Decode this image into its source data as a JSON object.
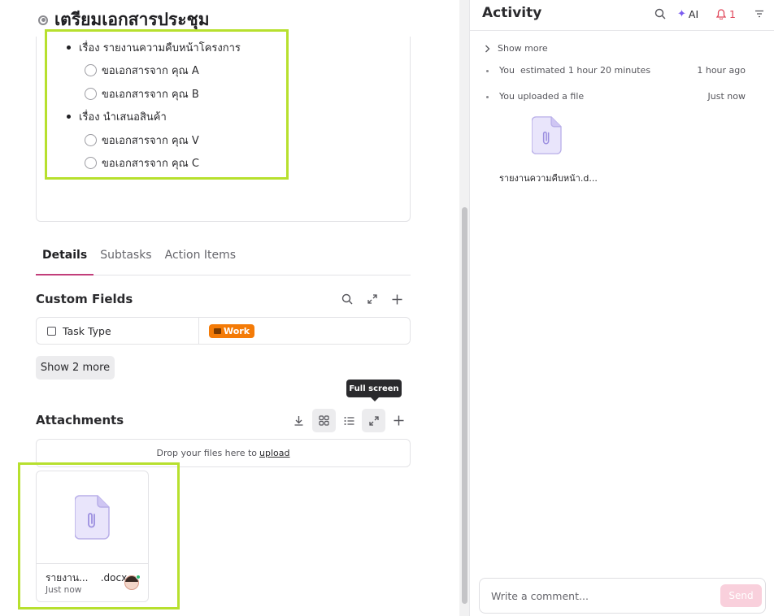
{
  "task": {
    "title": "เตรียมเอกสารประชุม"
  },
  "description": {
    "items": [
      {
        "label": "เรื่อง รายงานความคืบหน้าโครงการ",
        "children": [
          "ขอเอกสารจาก คุณ A",
          "ขอเอกสารจาก คุณ B"
        ]
      },
      {
        "label": "เรื่อง นำเสนอสินค้า",
        "children": [
          "ขอเอกสารจาก คุณ V",
          "ขอเอกสารจาก คุณ C"
        ]
      }
    ]
  },
  "tabs": [
    {
      "label": "Details",
      "active": true
    },
    {
      "label": "Subtasks",
      "active": false
    },
    {
      "label": "Action Items",
      "active": false
    }
  ],
  "custom_fields": {
    "title": "Custom Fields",
    "rows": [
      {
        "name": "Task Type",
        "value": "Work",
        "value_color": "#f47b07"
      }
    ],
    "show_more_label": "Show 2 more"
  },
  "attachments": {
    "title": "Attachments",
    "tooltip": "Full screen",
    "dropzone_text": "Drop your files here to",
    "dropzone_link": "upload",
    "files": [
      {
        "name": "รายงาน...",
        "ext": ".docx",
        "time": "Just now"
      }
    ]
  },
  "activity": {
    "title": "Activity",
    "ai_label": "AI",
    "notification_count": "1",
    "show_more": "Show more",
    "entries": [
      {
        "actor": "You",
        "text": "estimated 1 hour 20 minutes",
        "time": "1 hour ago"
      },
      {
        "actor": "You",
        "text": "uploaded a file",
        "time": "Just now"
      }
    ],
    "uploaded_file_name": "รายงานความคืบหน้า.d...",
    "comment_placeholder": "Write a comment...",
    "send_label": "Send"
  },
  "colors": {
    "accent_tab": "#c23e7a",
    "highlight": "#b7e02e",
    "file_icon": "#b8aee8",
    "send_button": "#f9d0dc"
  },
  "icons": {
    "status": "status-circle-icon",
    "search": "search-icon",
    "expand": "expand-icon",
    "add": "plus-icon",
    "download": "download-icon",
    "grid": "grid-view-icon",
    "list": "list-view-icon",
    "file": "paperclip-file-icon",
    "bell": "bell-icon",
    "filter": "filter-icon",
    "chevron": "chevron-right-icon"
  }
}
